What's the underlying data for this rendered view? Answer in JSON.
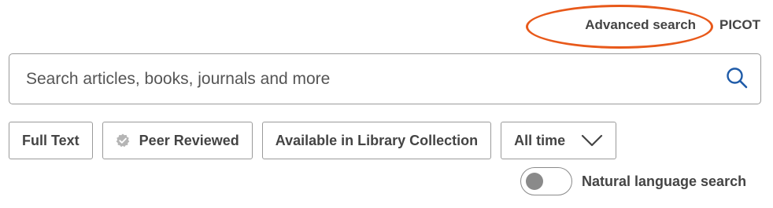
{
  "top_links": {
    "advanced_search": "Advanced search",
    "picot": "PICOT"
  },
  "search": {
    "placeholder": "Search articles, books, journals and more",
    "value": "",
    "icon": "search-icon"
  },
  "filters": [
    {
      "label": "Full Text",
      "icon": null
    },
    {
      "label": "Peer Reviewed",
      "icon": "verified-badge-icon"
    },
    {
      "label": "Available in Library Collection",
      "icon": null
    },
    {
      "label": "All time",
      "icon": "chevron-down-icon"
    }
  ],
  "natural_language": {
    "label": "Natural language search",
    "enabled": false
  },
  "colors": {
    "highlight_ring": "#e8591a",
    "search_icon": "#1f5ba8",
    "text": "#444444",
    "border": "#9a9a9a"
  }
}
